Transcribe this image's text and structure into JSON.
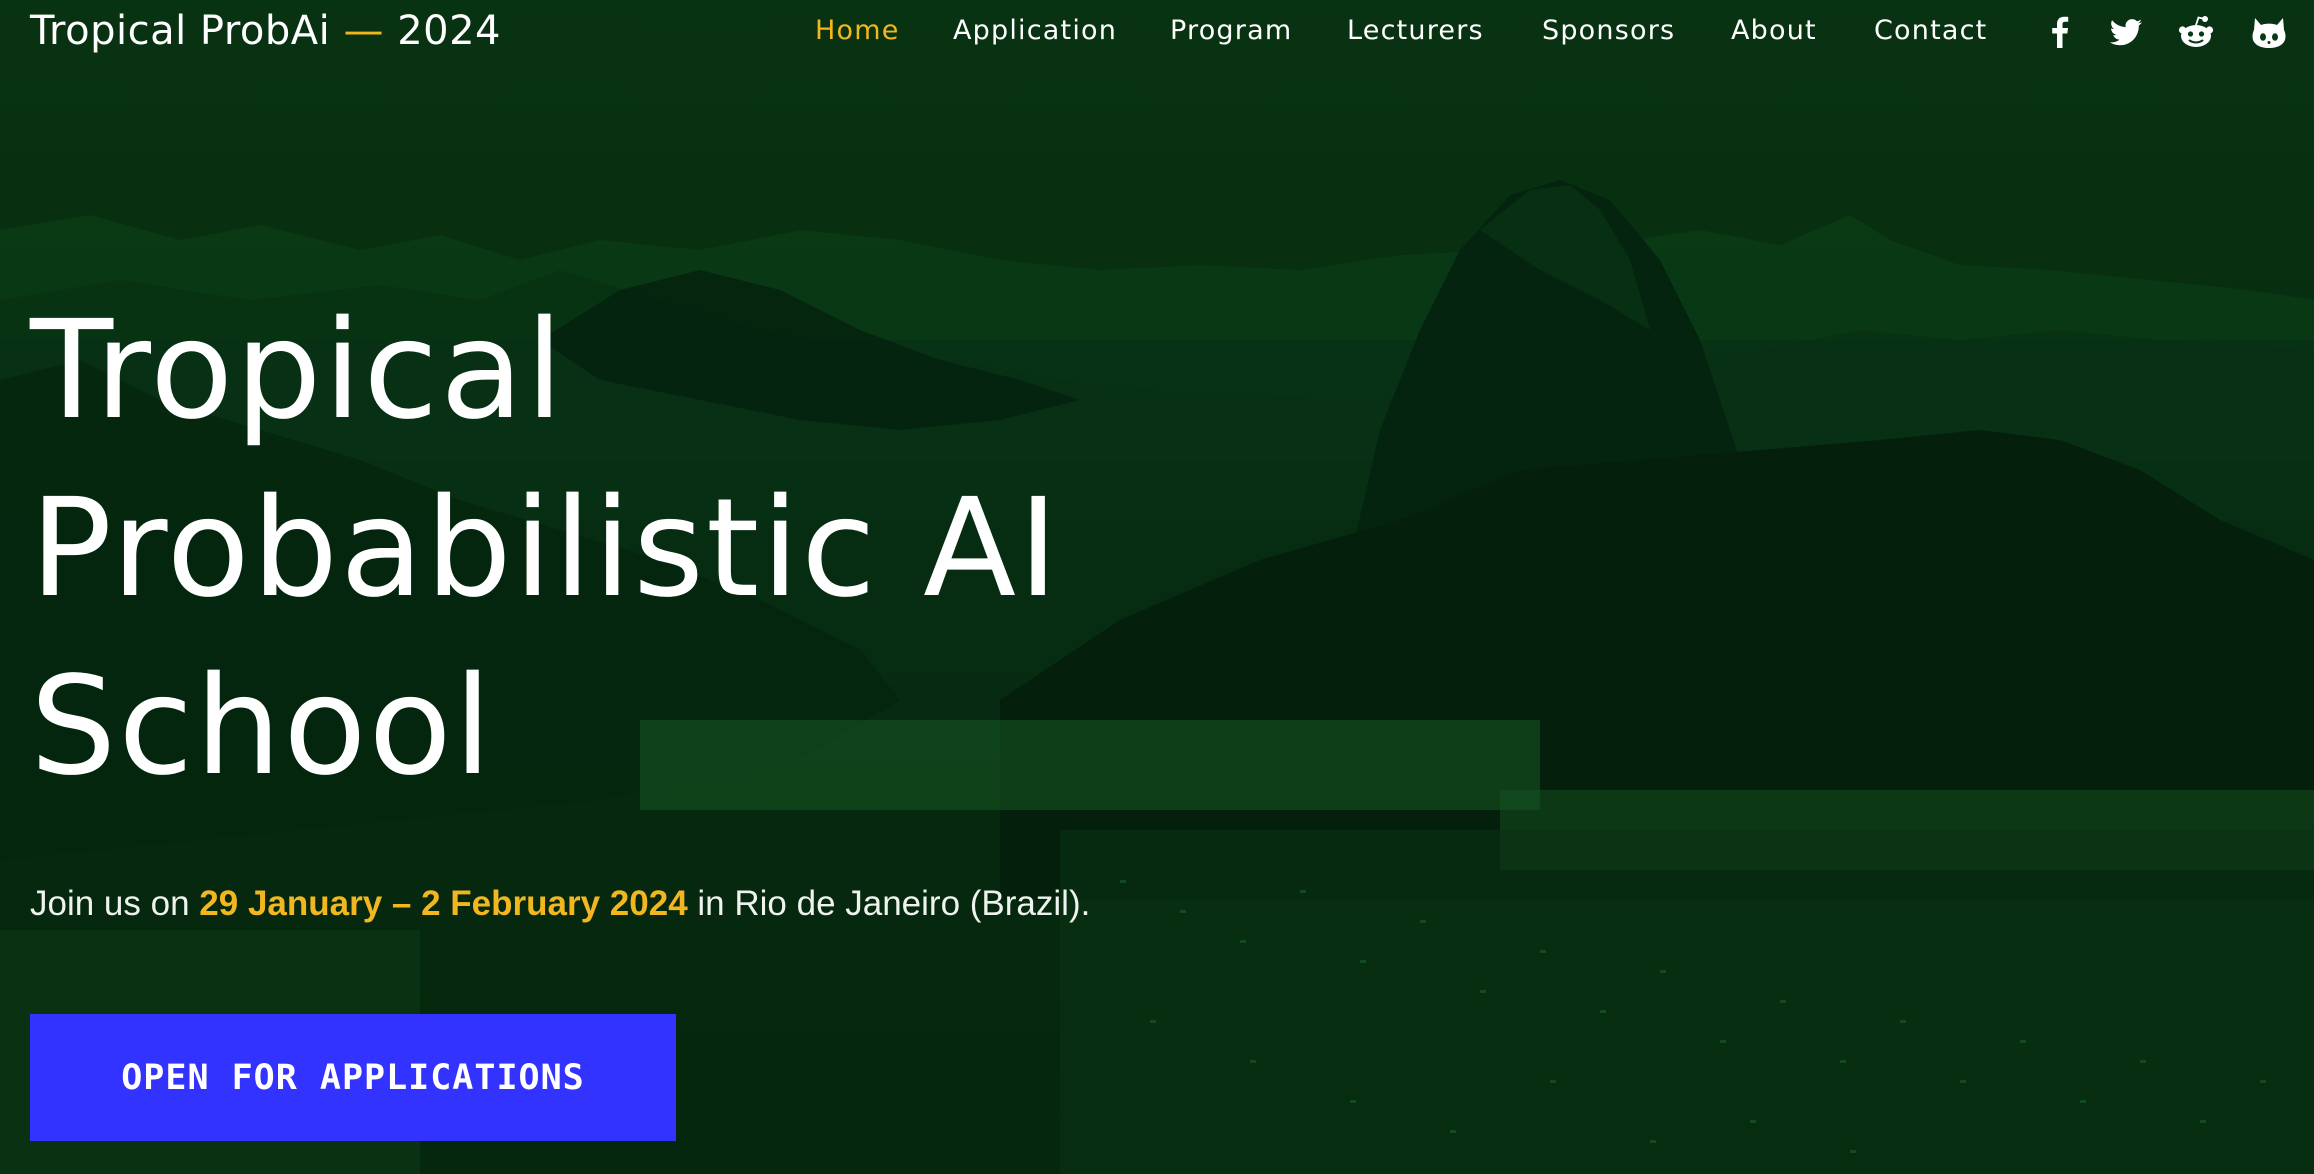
{
  "brand": {
    "name": "Tropical ProbAi",
    "separator": "—",
    "year": "2024"
  },
  "nav": {
    "items": [
      {
        "label": "Home",
        "active": true
      },
      {
        "label": "Application"
      },
      {
        "label": "Program"
      },
      {
        "label": "Lecturers"
      },
      {
        "label": "Sponsors"
      },
      {
        "label": "About"
      },
      {
        "label": "Contact"
      }
    ]
  },
  "social": [
    {
      "icon": "facebook-icon"
    },
    {
      "icon": "twitter-icon"
    },
    {
      "icon": "reddit-icon"
    },
    {
      "icon": "github-icon"
    }
  ],
  "hero": {
    "title_lines": [
      "Tropical",
      "Probabilistic AI",
      "School"
    ],
    "subtitle_prefix": "Join us on",
    "subtitle_dates": "29 January – 2 February 2024",
    "subtitle_suffix": "in Rio de Janeiro (Brazil).",
    "cta_label": "OPEN FOR APPLICATIONS"
  },
  "colors": {
    "accent": "#f2b61f",
    "cta_background": "#3333ff",
    "overlay_green": "#083211"
  }
}
